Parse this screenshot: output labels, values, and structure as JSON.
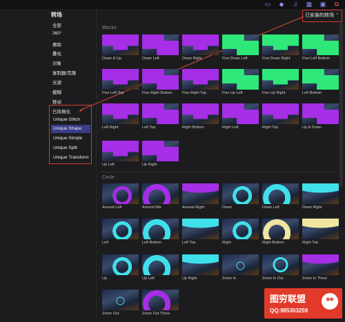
{
  "sidebar": {
    "title": "转场",
    "categories": [
      "全部",
      "360°",
      "擦除",
      "叠化",
      "对象",
      "复制器/克隆",
      "光源",
      "模糊",
      "移动",
      "已风格化"
    ],
    "unique_items": [
      "Unique Glitch",
      "Unique Shape",
      "Unique Simple",
      "Unique Split",
      "Unique Transform"
    ],
    "selected": "Unique Shape"
  },
  "header": {
    "dropdown_label": "已安装的转场",
    "dropdown_chevron": "⌃"
  },
  "sections": {
    "blocks": {
      "title": "Blocks",
      "items": [
        "Down & Up",
        "Down Left",
        "Down Right",
        "Five Down Left",
        "Five Down Right",
        "Five Left Bottom",
        "Five Left Top",
        "Five Right Bottom",
        "Five Right Top",
        "Five Up Left",
        "Five Up Right",
        "Left Bottom",
        "Left Right",
        "Left Top",
        "Right Bottom",
        "Right Left",
        "Right Top",
        "Up & Down",
        "Up Left",
        "Up Right"
      ]
    },
    "circle": {
      "title": "Circle",
      "items": [
        "Around Left",
        "Around Mix",
        "Around Right",
        "Down",
        "Down Left",
        "Down Right",
        "Left",
        "Left Bottom",
        "Left Top",
        "Right",
        "Right Bottom",
        "Right Top",
        "Up",
        "Up Left",
        "Up Right",
        "Zoom In",
        "Zoom In Out",
        "Zoom In Three",
        "Zoom Out",
        "Zoom Out Three"
      ]
    }
  },
  "watermark": {
    "title": "图穷联盟",
    "qq": "QQ:985303259"
  },
  "colors": {
    "purple": "#a52ee6",
    "green": "#2ee87a",
    "cyan": "#3fe0ea",
    "yellow": "#f0e6a0",
    "accent_red": "#d93a2f",
    "selection": "#3a3c88"
  }
}
